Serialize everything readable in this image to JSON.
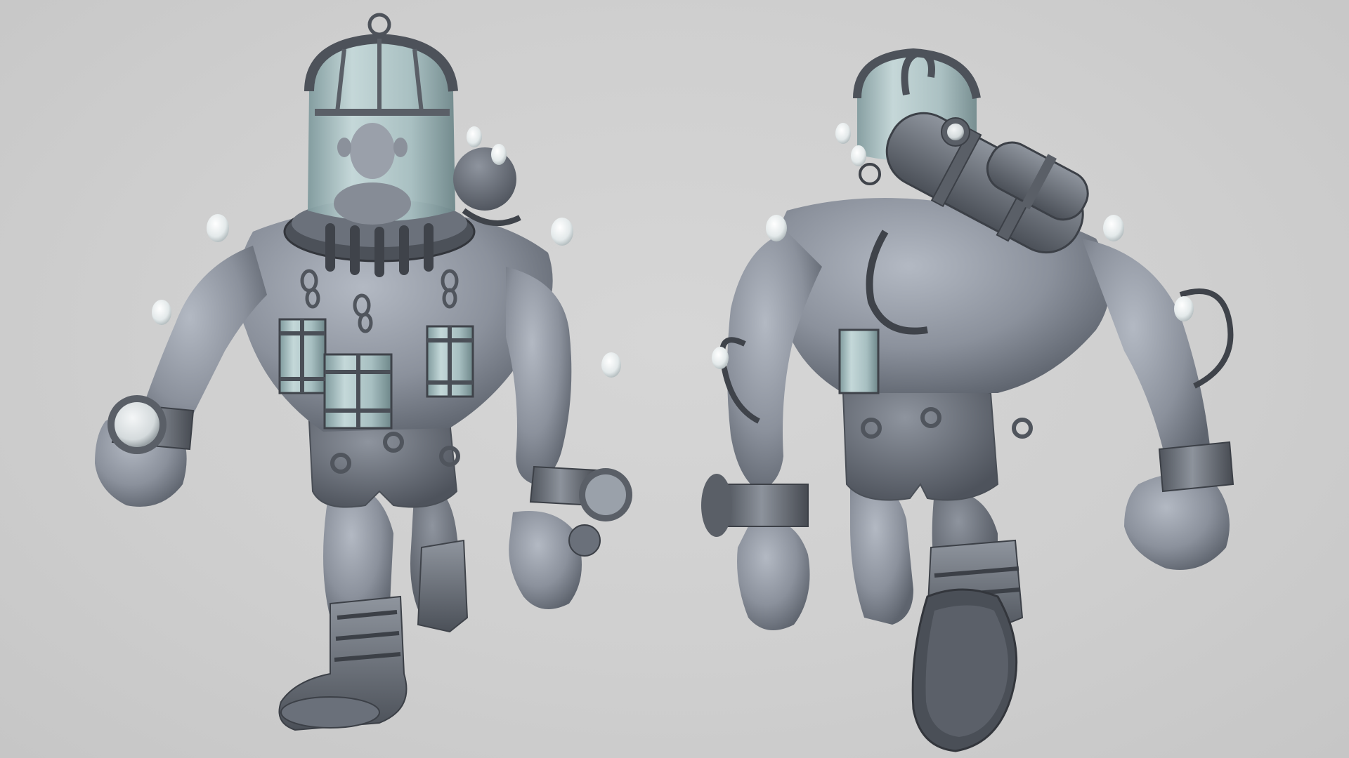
{
  "scene": {
    "kind": "3d-sculpt-render",
    "background_color": "#cfcfcf",
    "material_color": "#8d939e",
    "material_dark": "#5c626d",
    "material_light": "#b8bdc6",
    "glass_color": "#a9c4c6",
    "bulb_color": "#eef2f2",
    "figures": [
      {
        "view": "front",
        "subject": "diver-suit-giant-with-gnome-pilot"
      },
      {
        "view": "back",
        "subject": "diver-suit-giant-with-air-tanks"
      }
    ]
  }
}
